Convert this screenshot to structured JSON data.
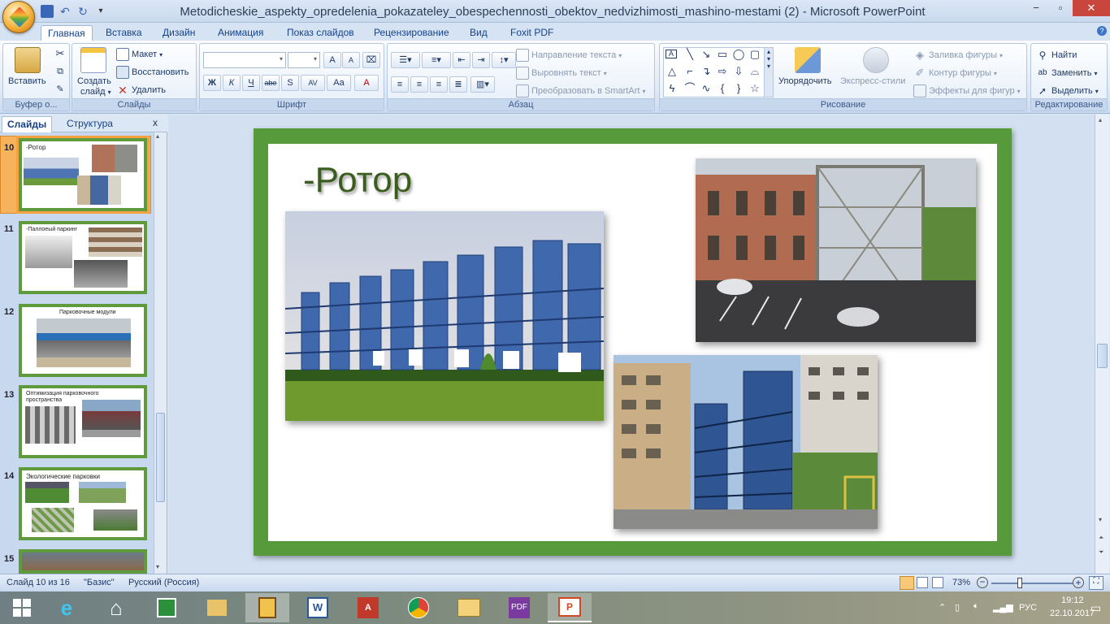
{
  "window": {
    "title": "Metodicheskie_aspekty_opredelenia_pokazateley_obespechennosti_obektov_nedvizhimosti_mashino-mestami (2) - Microsoft PowerPoint",
    "minimize": "−",
    "maximize": "▫",
    "close": "✕"
  },
  "ribbon_tabs": [
    "Главная",
    "Вставка",
    "Дизайн",
    "Анимация",
    "Показ слайдов",
    "Рецензирование",
    "Вид",
    "Foxit PDF"
  ],
  "ribbon": {
    "clipboard": {
      "paste": "Вставить",
      "label": "Буфер о..."
    },
    "slides": {
      "create": "Создать",
      "create2": "слайд",
      "layout": "Макет",
      "reset": "Восстановить",
      "delete": "Удалить",
      "label": "Слайды"
    },
    "font": {
      "label": "Шрифт",
      "bold": "Ж",
      "italic": "К",
      "underline": "Ч",
      "strike": "abe",
      "shadow": "S",
      "spacing": "AV",
      "case": "Aa",
      "color": "A",
      "grow": "A",
      "shrink": "A"
    },
    "paragraph": {
      "text_direction": "Направление текста",
      "align_text": "Выровнять текст",
      "smartart": "Преобразовать в SmartArt",
      "label": "Абзац"
    },
    "drawing": {
      "arrange": "Упорядочить",
      "quick_styles": "Экспресс-стили",
      "fill": "Заливка фигуры",
      "outline": "Контур фигуры",
      "effects": "Эффекты для фигур",
      "label": "Рисование"
    },
    "editing": {
      "find": "Найти",
      "replace": "Заменить",
      "select": "Выделить",
      "label": "Редактирование"
    }
  },
  "pane": {
    "tab_slides": "Слайды",
    "tab_outline": "Структура",
    "close": "x",
    "thumbnails": [
      {
        "num": "10",
        "title": "-Ротор"
      },
      {
        "num": "11",
        "title": "-Паллоеый паркинг"
      },
      {
        "num": "12",
        "title": "Парковочные модули"
      },
      {
        "num": "13",
        "title": "Оптимизация парковочного пространства"
      },
      {
        "num": "14",
        "title": "Экологические парковки"
      },
      {
        "num": "15",
        "title": ""
      }
    ]
  },
  "slide": {
    "title": "-Ротор"
  },
  "status": {
    "slide_info": "Слайд 10 из 16",
    "theme": "\"Базис\"",
    "language": "Русский (Россия)",
    "zoom": "73%",
    "zoom_level": 0.73
  },
  "taskbar": {
    "language": "РУС",
    "time": "19:12",
    "date": "22.10.2017"
  }
}
